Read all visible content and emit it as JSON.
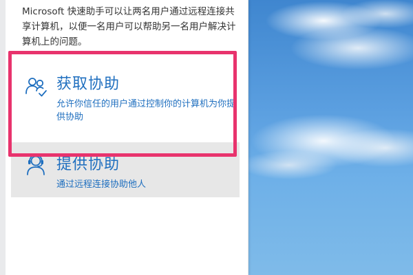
{
  "intro_text": "Microsoft 快速助手可以让两名用户通过远程连接共享计算机，以便一名用户可以帮助另一名用户解决计算机上的问题。",
  "options": {
    "get_help": {
      "title": "获取协助",
      "description": "允许你信任的用户通过控制你的计算机为你提供协助",
      "icon": "people-check-icon"
    },
    "give_help": {
      "title": "提供协助",
      "description": "通过远程连接协助他人",
      "icon": "headset-person-icon"
    }
  },
  "colors": {
    "accent": "#1f6fbf",
    "highlight": "#e8336d",
    "selected_bg": "#e7e7e7"
  }
}
